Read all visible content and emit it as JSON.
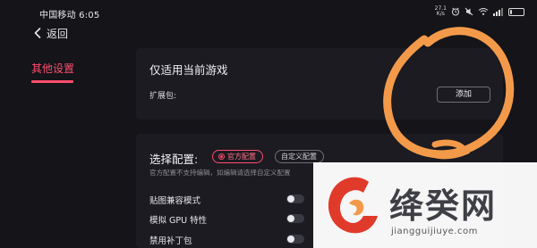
{
  "status_bar": {
    "carrier_time": "中国移动 6:05",
    "net_speed_value": "27.1",
    "net_speed_unit": "K/s",
    "battery": "9",
    "battery_fraction": 0.12
  },
  "nav": {
    "back_label": "返回"
  },
  "sidebar": {
    "items": [
      {
        "label": "其他设置",
        "selected": true
      }
    ]
  },
  "game_section": {
    "title": "仅适用当前游戏",
    "expansion_label": "扩展包:",
    "add_button": "添加"
  },
  "config_section": {
    "title": "选择配置:",
    "options": [
      {
        "label": "官方配置",
        "selected": true
      },
      {
        "label": "自定义配置",
        "selected": false
      }
    ],
    "hint": "官方配置不支持编辑，如编辑请选择自定义配置",
    "toggles": [
      {
        "label": "贴图兼容模式",
        "on": false
      },
      {
        "label": "模拟 GPU 特性",
        "on": false
      },
      {
        "label": "禁用补丁包",
        "on": false
      }
    ]
  },
  "watermark": {
    "name": "绛癸网",
    "domain": "jiangguijiuye.com"
  },
  "colors": {
    "background": "#141419",
    "panel": "#1b1b21",
    "accent": "#ff4d6d",
    "scribble": "#f39a4a",
    "watermark_red": "#e03a2b"
  }
}
